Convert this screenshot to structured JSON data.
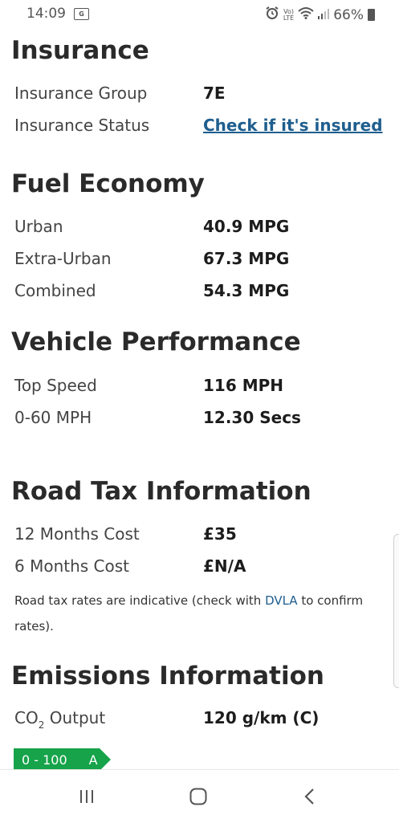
{
  "status_bar": {
    "time": "14:09",
    "gallery_badge": "G",
    "volte_top": "Vo)",
    "volte_bottom": "LTE",
    "battery_percent": "66%"
  },
  "insurance": {
    "title": "Insurance",
    "group_label": "Insurance Group",
    "group_value": "7E",
    "status_label": "Insurance Status",
    "status_link": "Check if it's insured"
  },
  "fuel_economy": {
    "title": "Fuel Economy",
    "rows": [
      {
        "label": "Urban",
        "value": "40.9 MPG"
      },
      {
        "label": "Extra-Urban",
        "value": "67.3 MPG"
      },
      {
        "label": "Combined",
        "value": "54.3 MPG"
      }
    ]
  },
  "performance": {
    "title": "Vehicle Performance",
    "rows": [
      {
        "label": "Top Speed",
        "value": "116 MPH"
      },
      {
        "label": "0-60 MPH",
        "value": "12.30 Secs"
      }
    ]
  },
  "road_tax": {
    "title": "Road Tax Information",
    "rows": [
      {
        "label": "12 Months Cost",
        "value": "£35"
      },
      {
        "label": "6 Months Cost",
        "value": "£N/A"
      }
    ],
    "note_prefix": "Road tax rates are indicative (check with ",
    "note_link": "DVLA",
    "note_suffix": " to confirm rates)."
  },
  "emissions": {
    "title": "Emissions Information",
    "co2_label_main": "CO",
    "co2_label_sub": "2",
    "co2_label_rest": " Output",
    "co2_value": "120 g/km (C)",
    "band_range": "0 - 100",
    "band_letter": "A"
  },
  "colors": {
    "accent_link": "#1f5e8e",
    "band_green": "#16a34a"
  },
  "nav_icons": [
    "recent-apps-icon",
    "home-icon",
    "back-icon"
  ]
}
